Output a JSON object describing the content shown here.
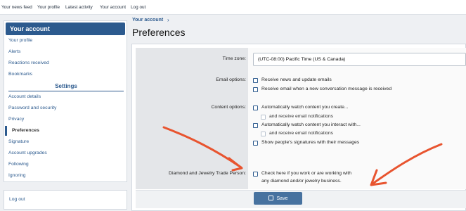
{
  "topnav": [
    "Your news feed",
    "Your profile",
    "Latest activity",
    "Your account",
    "Log out"
  ],
  "sidebar": {
    "header": "Your account",
    "items1": [
      "Your profile",
      "Alerts",
      "Reactions received",
      "Bookmarks"
    ],
    "section": "Settings",
    "items2": [
      "Account details",
      "Password and security",
      "Privacy"
    ],
    "active": "Preferences",
    "items3": [
      "Signature",
      "Account upgrades",
      "Following",
      "Ignoring"
    ],
    "logout": "Log out"
  },
  "breadcrumb": "Your account",
  "page_title": "Preferences",
  "form": {
    "timezone_label": "Time zone:",
    "timezone_value": "(UTC-08:00) Pacific Time (US & Canada)",
    "email_label": "Email options:",
    "email_opts": [
      "Receive news and update emails",
      "Receive email when a new conversation message is received"
    ],
    "content_label": "Content options:",
    "content_opts": [
      "Automatically watch content you create...",
      "and receive email notifications",
      "Automatically watch content you interact with...",
      "and receive email notifications",
      "Show people's signatures with their messages"
    ],
    "trade_label": "Diamond and Jewelry Trade Person:",
    "trade_line1": "Check here if you work or are working with",
    "trade_line2": "any diamond and/or jewelry business.",
    "save": "Save"
  },
  "colors": {
    "accent": "#2c5a8e",
    "annotation_arrow": "#e8542f"
  }
}
